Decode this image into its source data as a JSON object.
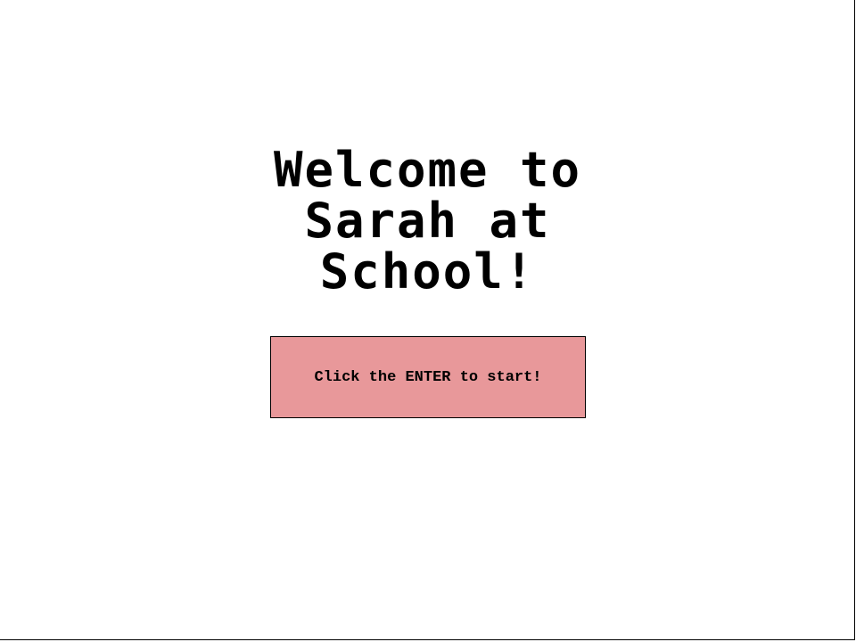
{
  "screen": {
    "title": "Welcome to\nSarah at\nSchool!",
    "start_button_label": "Click the ENTER to start!"
  },
  "colors": {
    "background": "#ffffff",
    "button_fill": "#e8989a",
    "border": "#000000",
    "text": "#000000"
  }
}
